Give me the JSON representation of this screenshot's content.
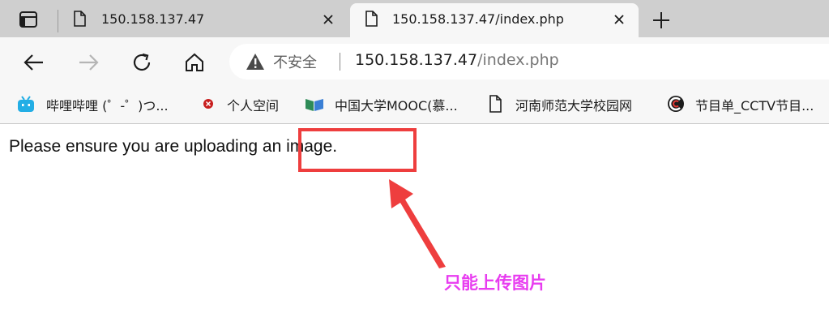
{
  "tabs": [
    {
      "title": "150.158.137.47",
      "active": false
    },
    {
      "title": "150.158.137.47/index.php",
      "active": true
    }
  ],
  "address": {
    "security_label": "不安全",
    "url_host": "150.158.137.47",
    "url_path": "/index.php"
  },
  "bookmarks": [
    {
      "label": "哔哩哔哩 (゜-゜)つ...",
      "icon": "bilibili-icon"
    },
    {
      "label": "个人空间",
      "icon": "red-dot-icon"
    },
    {
      "label": "中国大学MOOC(慕...",
      "icon": "mooc-icon"
    },
    {
      "label": "河南师范大学校园网",
      "icon": "page-icon"
    },
    {
      "label": "节目单_CCTV节目...",
      "icon": "cctv-icon"
    }
  ],
  "page": {
    "message": "Please ensure you are uploading an image."
  },
  "annotation": {
    "text": "只能上传图片",
    "color": "#e83cf0",
    "box_color": "#ee3e3e"
  }
}
